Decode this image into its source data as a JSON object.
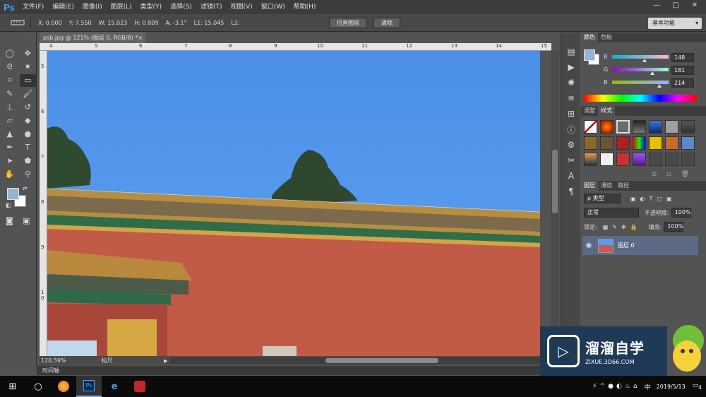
{
  "app": {
    "logo": "Ps",
    "menu": [
      "文件(F)",
      "编辑(E)",
      "图像(I)",
      "图层(L)",
      "类型(Y)",
      "选择(S)",
      "滤镜(T)",
      "视图(V)",
      "窗口(W)",
      "帮助(H)"
    ],
    "window_controls": [
      "—",
      "□",
      "✕"
    ]
  },
  "options_bar": {
    "x": "X: 0.000",
    "y": "Y: 7.550",
    "w": "W: 15.023",
    "h": "H: 0.809",
    "a": "A: -3.1°",
    "l1": "L1: 15.045",
    "l2": "L2:",
    "straighten_button": "拉直图层",
    "clear_button": "清除",
    "workspace": "基本功能"
  },
  "document": {
    "tab_title": "psb.jpg @ 121% (图层 0, RGB/8) *",
    "tab_close": "×",
    "ruler_top": [
      "4",
      "5",
      "6",
      "7",
      "8",
      "9",
      "10",
      "11",
      "12",
      "13",
      "14",
      "15"
    ],
    "ruler_left": [
      "5",
      "6",
      "7",
      "8",
      "9",
      "1 0"
    ]
  },
  "status": {
    "zoom": "120.59%",
    "info": "标尺",
    "timeline": "时间轴"
  },
  "color_panel": {
    "tabs": [
      "颜色",
      "色板"
    ],
    "r_label": "R",
    "r_value": "148",
    "g_label": "G",
    "g_value": "181",
    "b_label": "B",
    "b_value": "214",
    "r_level": 0.58,
    "g_level": 0.71,
    "b_level": 0.84,
    "foreground": "#94b5d6"
  },
  "styles_panel": {
    "tabs": [
      "调整",
      "样式"
    ]
  },
  "layers_panel": {
    "tabs": [
      "图层",
      "通道",
      "路径"
    ],
    "filter_kind": "ρ 类型",
    "blend_mode": "正常",
    "opacity_label": "不透明度:",
    "opacity_value": "100%",
    "lock_label": "锁定:",
    "fill_label": "填充:",
    "fill_value": "100%",
    "layer_name": "图层 0"
  },
  "watermark": {
    "title": "溜溜自学",
    "url": "ZIXUE.3D66.COM"
  },
  "taskbar": {
    "time": "",
    "date": "2019/5/13",
    "notification_count": "4",
    "ime": "中"
  },
  "colors": {
    "accent": "#31a8ff",
    "sky": "#4f95ea",
    "wall": "#c25a48",
    "layer_highlight": "#5b6b85"
  }
}
